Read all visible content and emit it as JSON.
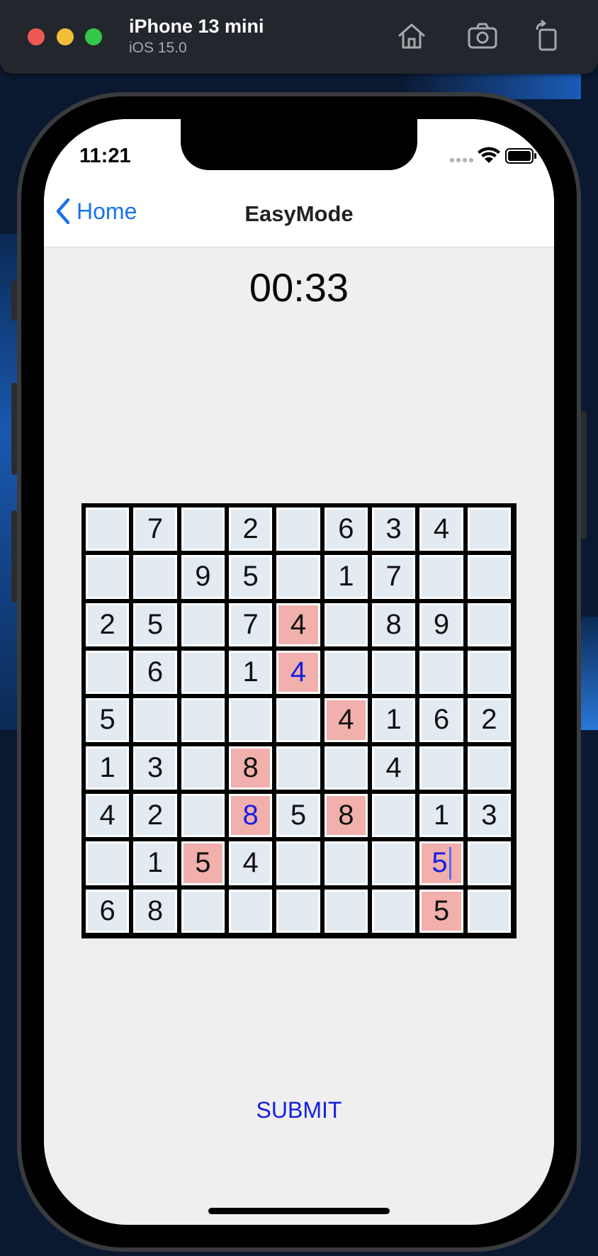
{
  "simulator": {
    "device_name": "iPhone 13 mini",
    "os_version": "iOS 15.0",
    "toolbar_icons": [
      "home-icon",
      "screenshot-icon",
      "rotate-icon"
    ]
  },
  "status_bar": {
    "time": "11:21",
    "icons": [
      "signal-icon",
      "wifi-icon",
      "battery-icon"
    ]
  },
  "nav": {
    "back_label": "Home",
    "title": "EasyMode"
  },
  "timer": "00:33",
  "board": {
    "rows": [
      [
        "",
        "7",
        "",
        "2",
        "",
        "6",
        "3",
        "4",
        ""
      ],
      [
        "",
        "",
        "9",
        "5",
        "",
        "1",
        "7",
        "",
        ""
      ],
      [
        "2",
        "5",
        "",
        "7",
        "4",
        "",
        "8",
        "9",
        ""
      ],
      [
        "",
        "6",
        "",
        "1",
        "4",
        "",
        "",
        "",
        ""
      ],
      [
        "5",
        "",
        "",
        "",
        "",
        "4",
        "1",
        "6",
        "2"
      ],
      [
        "1",
        "3",
        "",
        "8",
        "",
        "",
        "4",
        "",
        ""
      ],
      [
        "4",
        "2",
        "",
        "8",
        "5",
        "8",
        "",
        "1",
        "3"
      ],
      [
        "",
        "1",
        "5",
        "4",
        "",
        "",
        "",
        "5",
        ""
      ],
      [
        "6",
        "8",
        "",
        "",
        "",
        "",
        "",
        "5",
        ""
      ]
    ],
    "conflict_cells": [
      [
        2,
        4
      ],
      [
        3,
        4
      ],
      [
        4,
        5
      ],
      [
        5,
        3
      ],
      [
        6,
        3
      ],
      [
        6,
        5
      ],
      [
        7,
        2
      ],
      [
        7,
        7
      ],
      [
        8,
        7
      ]
    ],
    "user_entered_cells": [
      [
        3,
        4
      ],
      [
        6,
        3
      ],
      [
        7,
        7
      ]
    ],
    "focused_cell": [
      7,
      7
    ],
    "cell_color": "#e2eaf2",
    "conflict_color": "#f1b0ab",
    "user_digit_color": "#1520e0"
  },
  "submit_label": "SUBMIT",
  "colors": {
    "accent": "#1a73e8",
    "screen_bg": "#efefef"
  }
}
